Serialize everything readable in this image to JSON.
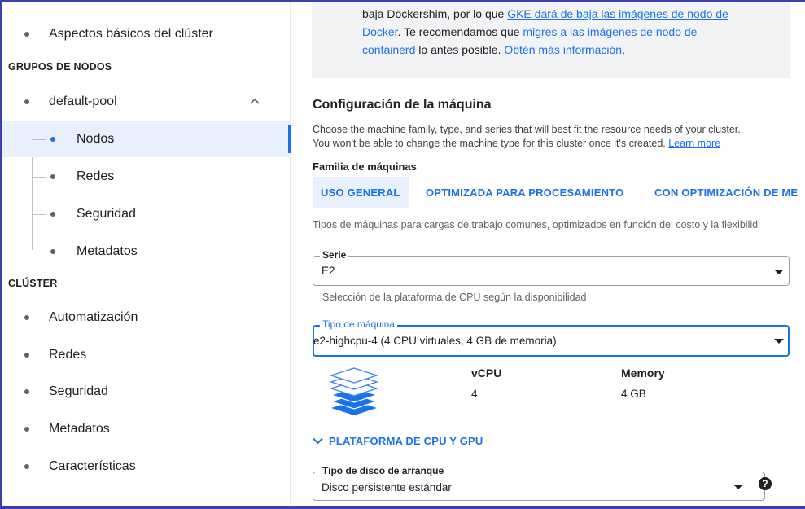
{
  "sidebar": {
    "top_item": "Aspectos básicos del clúster",
    "node_groups_header": "GRUPOS DE NODOS",
    "pool": "default-pool",
    "pool_children": [
      "Nodos",
      "Redes",
      "Seguridad",
      "Metadatos"
    ],
    "cluster_header": "CLÚSTER",
    "cluster_items": [
      "Automatización",
      "Redes",
      "Seguridad",
      "Metadatos",
      "Características"
    ]
  },
  "notice": {
    "line1_text": "baja Dockershim, por lo que ",
    "line1_link": "GKE dará de baja las imágenes de nodo de",
    "line2_link": "Docker",
    "line2_text": ". Te recomendamos que ",
    "line2_link2": "migres a las imágenes de nodo de",
    "line3_link": "containerd",
    "line3_text": " lo antes posible. ",
    "line3_link2": "Obtén más información",
    "line3_end": "."
  },
  "machine": {
    "title": "Configuración de la máquina",
    "desc_line1": "Choose the machine family, type, and series that will best fit the resource needs of your cluster.",
    "desc_line2": "You won't be able to change the machine type for this cluster once it's created. ",
    "learn_more": "Learn more",
    "family_label": "Familia de máquinas",
    "tabs": [
      "USO GENERAL",
      "OPTIMIZADA PARA PROCESAMIENTO",
      "CON OPTIMIZACIÓN DE ME"
    ],
    "family_desc": "Tipos de máquinas para cargas de trabajo comunes, optimizados en función del costo y la flexibilidi",
    "series_label": "Serie",
    "series_value": "E2",
    "series_hint": "Selección de la plataforma de CPU según la disponibilidad",
    "type_label": "Tipo de máquina",
    "type_value": "e2-highcpu-4 (4 CPU virtuales, 4 GB de memoria)",
    "vcpu_label": "vCPU",
    "vcpu_value": "4",
    "memory_label": "Memory",
    "memory_value": "4 GB",
    "cpu_gpu_toggle": "PLATAFORMA DE CPU Y GPU",
    "disk_label": "Tipo de disco de arranque",
    "disk_value": "Disco persistente estándar",
    "help_glyph": "?"
  },
  "colors": {
    "accent": "#1a73e8",
    "active_bg": "#e8f0fe",
    "notice_bg": "#f1f3f4",
    "frame": "#3b3fb0"
  },
  "icons": [
    "chevron-up-icon",
    "chevron-down-icon",
    "dropdown-caret-icon",
    "machine-stack-icon",
    "help-icon"
  ]
}
